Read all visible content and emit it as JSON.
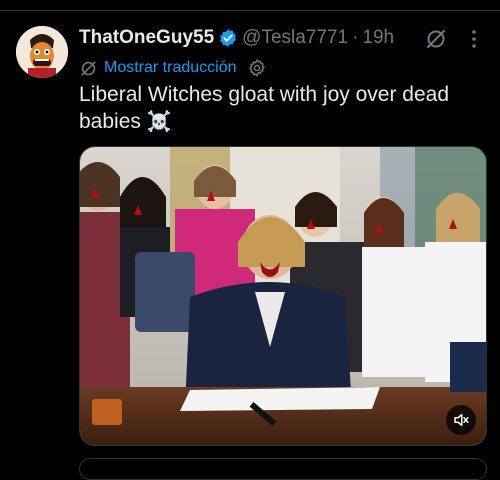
{
  "post": {
    "display_name": "ThatOneGuy55",
    "handle": "@Tesla7771",
    "separator": "·",
    "time": "19h",
    "translate_label": "Mostrar traducción",
    "text": "Liberal Witches gloat with joy over dead babies",
    "emoji": "☠️"
  },
  "icons": {
    "verified": "verified-badge-icon",
    "grok": "grok-icon",
    "more": "more-dots-icon",
    "translate": "translate-globe-icon",
    "settings": "gear-icon",
    "mute": "volume-muted-icon"
  },
  "colors": {
    "background": "#000000",
    "text": "#e7e9ea",
    "secondary": "#71767b",
    "link": "#1d9bf0",
    "divider": "#2f3336"
  }
}
